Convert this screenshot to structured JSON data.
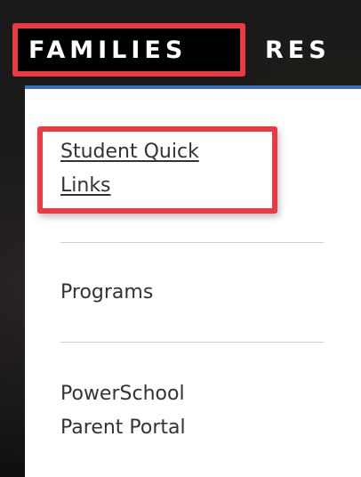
{
  "nav": {
    "families_label": "FAMILIES",
    "resources_label": "RES"
  },
  "dropdown": {
    "items": [
      {
        "label_line1": "Student Quick",
        "label_line2": "Links",
        "highlighted": true
      },
      {
        "label": "Programs"
      },
      {
        "label_line1": "PowerSchool",
        "label_line2": "Parent Portal"
      }
    ]
  },
  "colors": {
    "highlight": "#ea3b44",
    "dropdown_accent": "#3a6fc1",
    "nav_text": "#ffffff",
    "menu_text": "#333333"
  }
}
